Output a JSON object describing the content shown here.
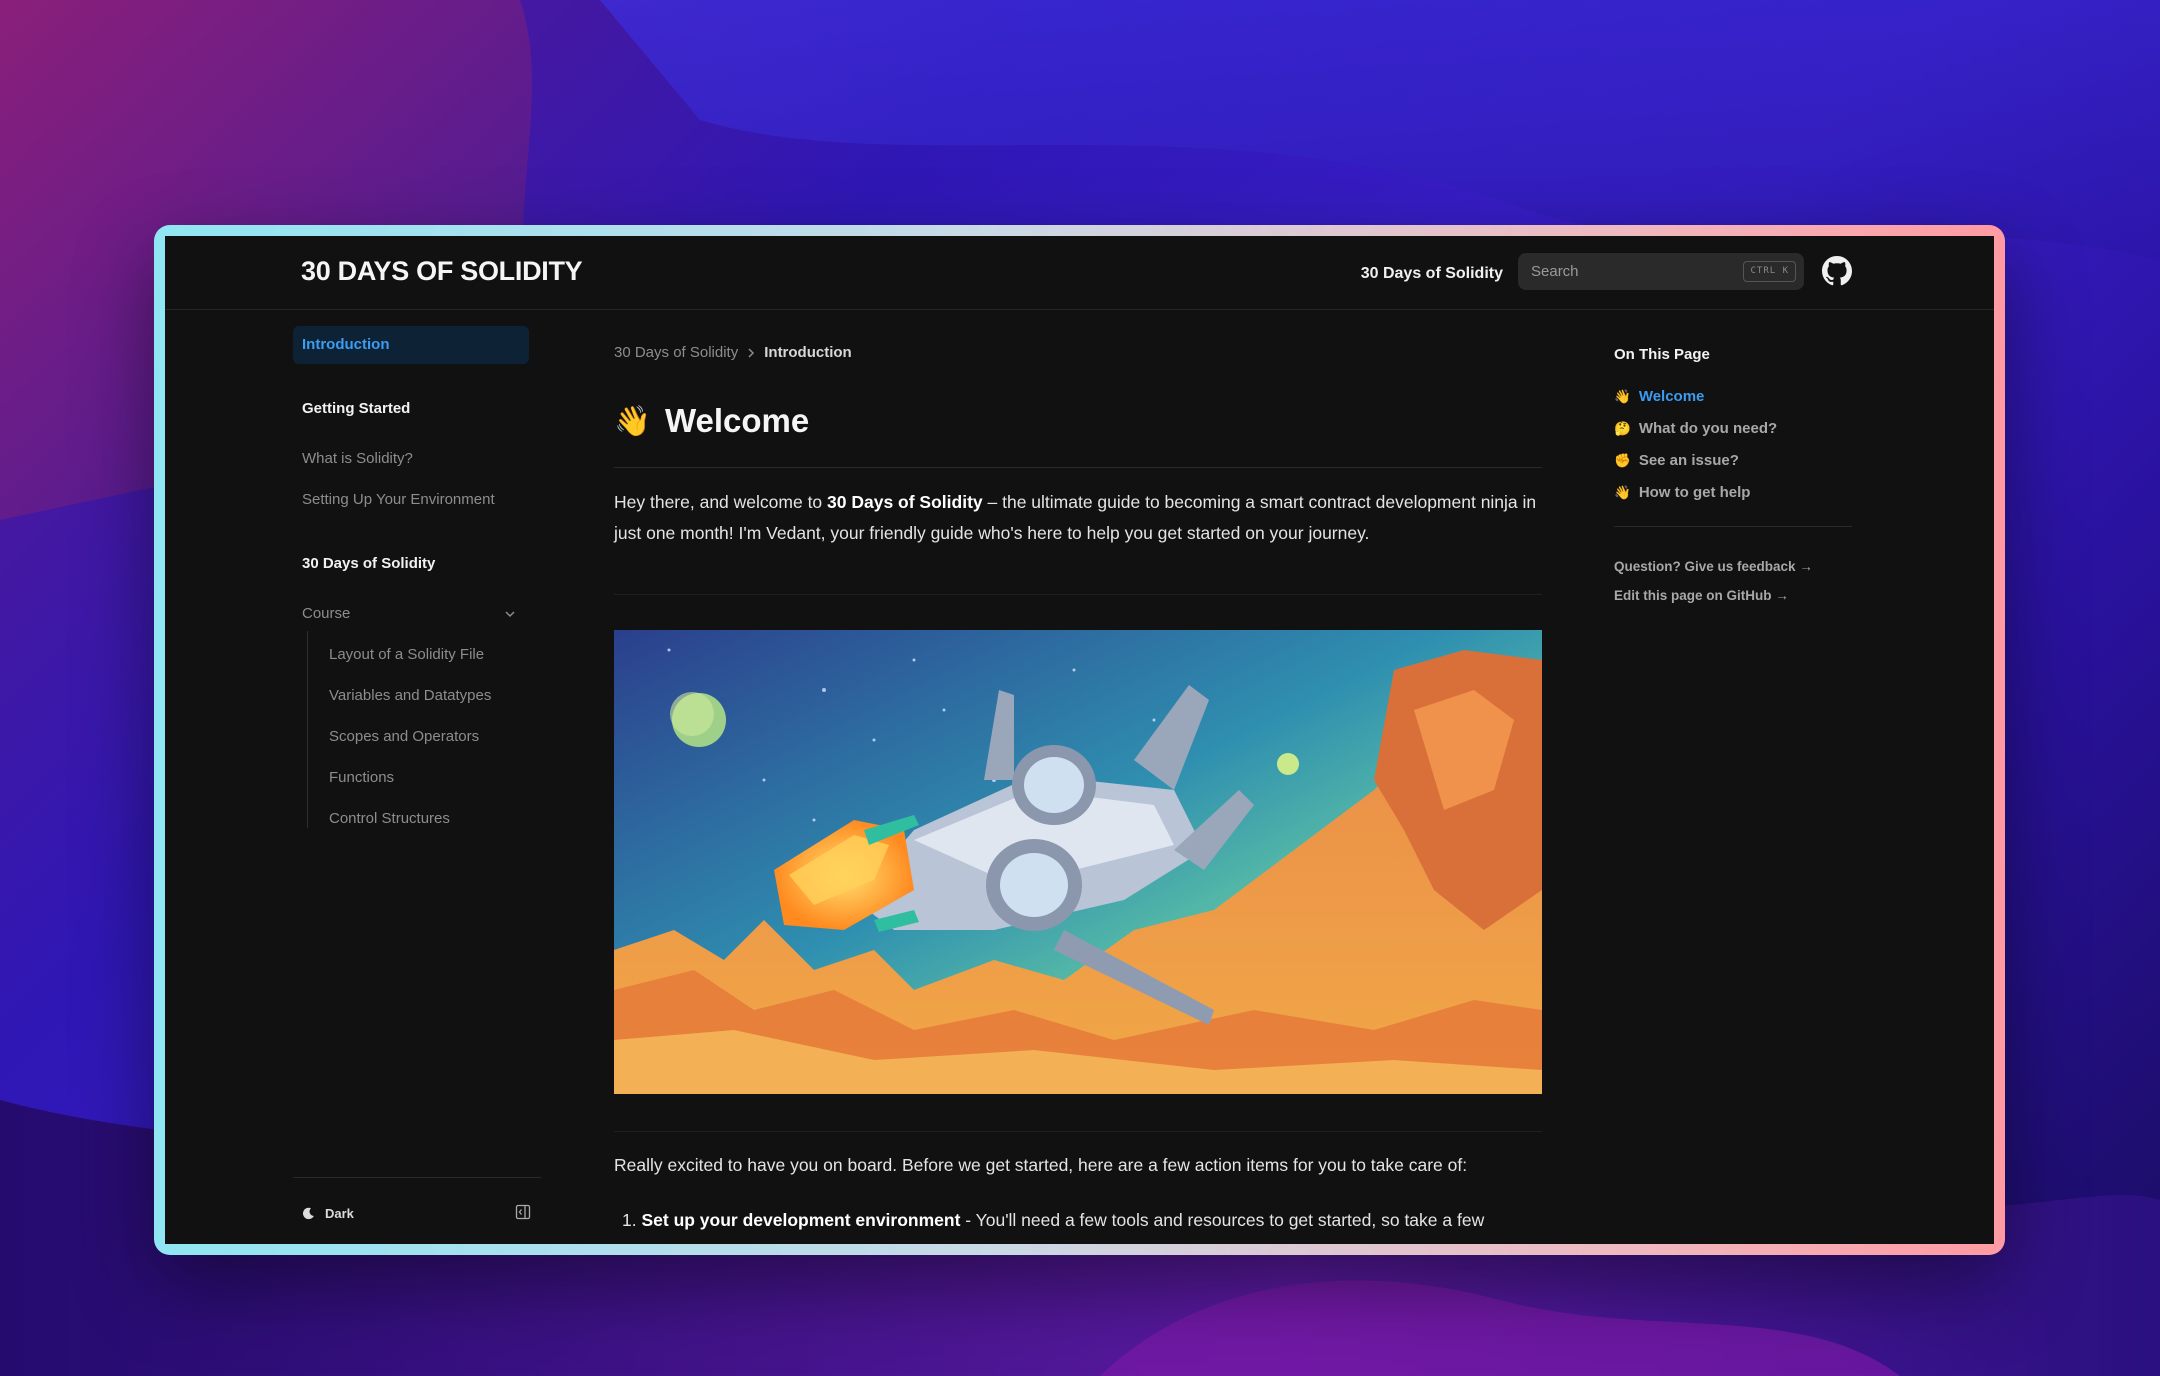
{
  "header": {
    "logo": "30 DAYS OF SOLIDITY",
    "nav_link": "30 Days of Solidity",
    "search_placeholder": "Search",
    "search_shortcut": "CTRL K",
    "github_icon": "github-icon"
  },
  "sidebar": {
    "active_item": "Introduction",
    "sections": [
      {
        "title": "Getting Started",
        "items": [
          "What is Solidity?",
          "Setting Up Your Environment"
        ]
      },
      {
        "title": "30 Days of Solidity",
        "group": "Course",
        "items": [
          "Layout of a Solidity File",
          "Variables and Datatypes",
          "Scopes and Operators",
          "Functions",
          "Control Structures"
        ]
      }
    ],
    "theme_label": "Dark"
  },
  "breadcrumb": {
    "root": "30 Days of Solidity",
    "current": "Introduction"
  },
  "content": {
    "title_emoji": "👋",
    "title": "Welcome",
    "intro_prefix": "Hey there, and welcome to ",
    "intro_bold": "30 Days of Solidity",
    "intro_suffix": " – the ultimate guide to becoming a smart contract development ninja in just one month! I'm Vedant, your friendly guide who's here to help you get started on your journey.",
    "para2": "Really excited to have you on board. Before we get started, here are a few action items for you to take care of:",
    "list_item_1_bold": "Set up your development environment",
    "list_item_1_rest": " - You'll need a few tools and resources to get started, so take a few"
  },
  "toc": {
    "title": "On This Page",
    "items": [
      {
        "emoji": "👋",
        "label": "Welcome",
        "active": true
      },
      {
        "emoji": "🤔",
        "label": "What do you need?"
      },
      {
        "emoji": "✊",
        "label": "See an issue?"
      },
      {
        "emoji": "👋",
        "label": "How to get help"
      }
    ],
    "feedback": "Question? Give us feedback →",
    "edit": "Edit this page on GitHub →"
  },
  "colors": {
    "accent": "#3b9cf0",
    "background": "#111111"
  }
}
